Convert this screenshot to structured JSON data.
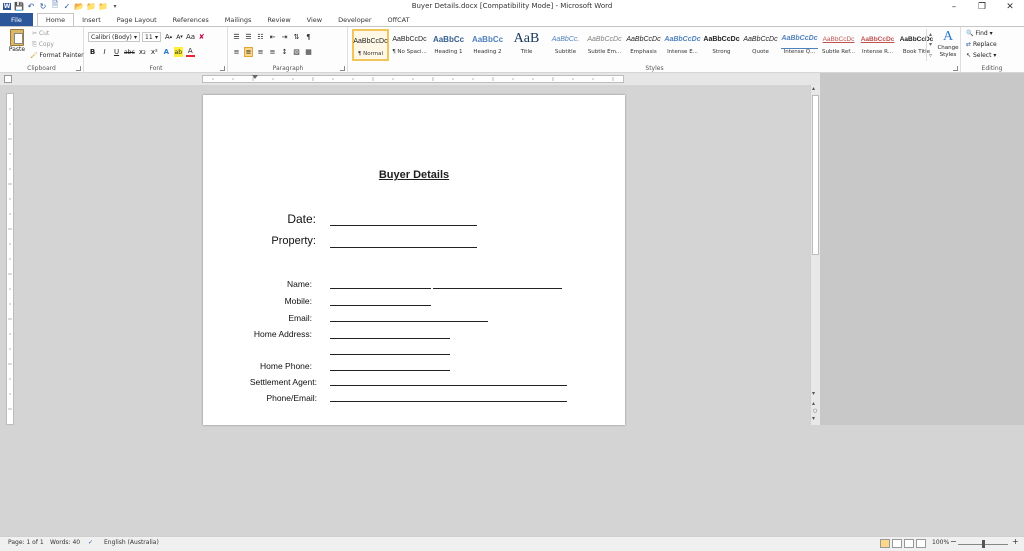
{
  "window": {
    "title": "Buyer Details.docx [Compatibility Mode]  -  Microsoft Word",
    "min_icon": "minimize-icon",
    "restore_icon": "restore-icon",
    "close_icon": "close-icon"
  },
  "quick_access": {
    "icons": [
      "word-logo-icon",
      "save-icon",
      "undo-icon",
      "redo-icon",
      "refresh-icon",
      "print-preview-icon",
      "spelling-icon",
      "open-icon",
      "folder-icon",
      "new-folder-icon",
      "customize-icon"
    ]
  },
  "tabs": [
    "File",
    "Home",
    "Insert",
    "Page Layout",
    "References",
    "Mailings",
    "Review",
    "View",
    "Developer",
    "OffCAT"
  ],
  "ribbon": {
    "clipboard": {
      "paste": "Paste",
      "cut": "Cut",
      "copy": "Copy",
      "format_painter": "Format Painter",
      "label": "Clipboard"
    },
    "font": {
      "name": "Calibri (Body)",
      "size": "11",
      "label": "Font",
      "grow": "A",
      "shrink": "A",
      "case": "Aa",
      "bold": "B",
      "italic": "I",
      "underline": "U",
      "strike": "abc",
      "sub": "x₂",
      "sup": "x²",
      "effects": "A",
      "highlight": "ab",
      "color": "A"
    },
    "paragraph": {
      "label": "Paragraph",
      "pilcrow": "¶"
    },
    "styles": {
      "label": "Styles",
      "items": [
        {
          "preview": "AaBbCcDc",
          "name": "¶ Normal"
        },
        {
          "preview": "AaBbCcDc",
          "name": "¶ No Spaci..."
        },
        {
          "preview": "AaBbCc",
          "name": "Heading 1"
        },
        {
          "preview": "AaBbCc",
          "name": "Heading 2"
        },
        {
          "preview": "AaB",
          "name": "Title"
        },
        {
          "preview": "AaBbCc.",
          "name": "Subtitle"
        },
        {
          "preview": "AaBbCcDc",
          "name": "Subtle Em..."
        },
        {
          "preview": "AaBbCcDc",
          "name": "Emphasis"
        },
        {
          "preview": "AaBbCcDc",
          "name": "Intense E..."
        },
        {
          "preview": "AaBbCcDc",
          "name": "Strong"
        },
        {
          "preview": "AaBbCcDc",
          "name": "Quote"
        },
        {
          "preview": "AaBbCcDc",
          "name": "Intense Q..."
        },
        {
          "preview": "AaBbCcDc",
          "name": "Subtle Ref..."
        },
        {
          "preview": "AaBbCcDc",
          "name": "Intense R..."
        },
        {
          "preview": "AaBbCcDc",
          "name": "Book Title"
        }
      ],
      "change_styles": "Change Styles"
    },
    "editing": {
      "label": "Editing",
      "find": "Find",
      "replace": "Replace",
      "select": "Select"
    }
  },
  "document": {
    "title": "Buyer Details",
    "date_label": "Date:",
    "property_label": "Property:",
    "fields": [
      {
        "label": "Name:"
      },
      {
        "label": "Mobile:"
      },
      {
        "label": "Email:"
      },
      {
        "label": "Home Address:"
      },
      {
        "label": ""
      },
      {
        "label": "Home Phone:"
      },
      {
        "label": "Settlement Agent:"
      },
      {
        "label": "Phone/Email:"
      }
    ]
  },
  "status": {
    "page": "Page: 1 of 1",
    "words": "Words: 40",
    "language": "English (Australia)",
    "zoom": "100%"
  }
}
